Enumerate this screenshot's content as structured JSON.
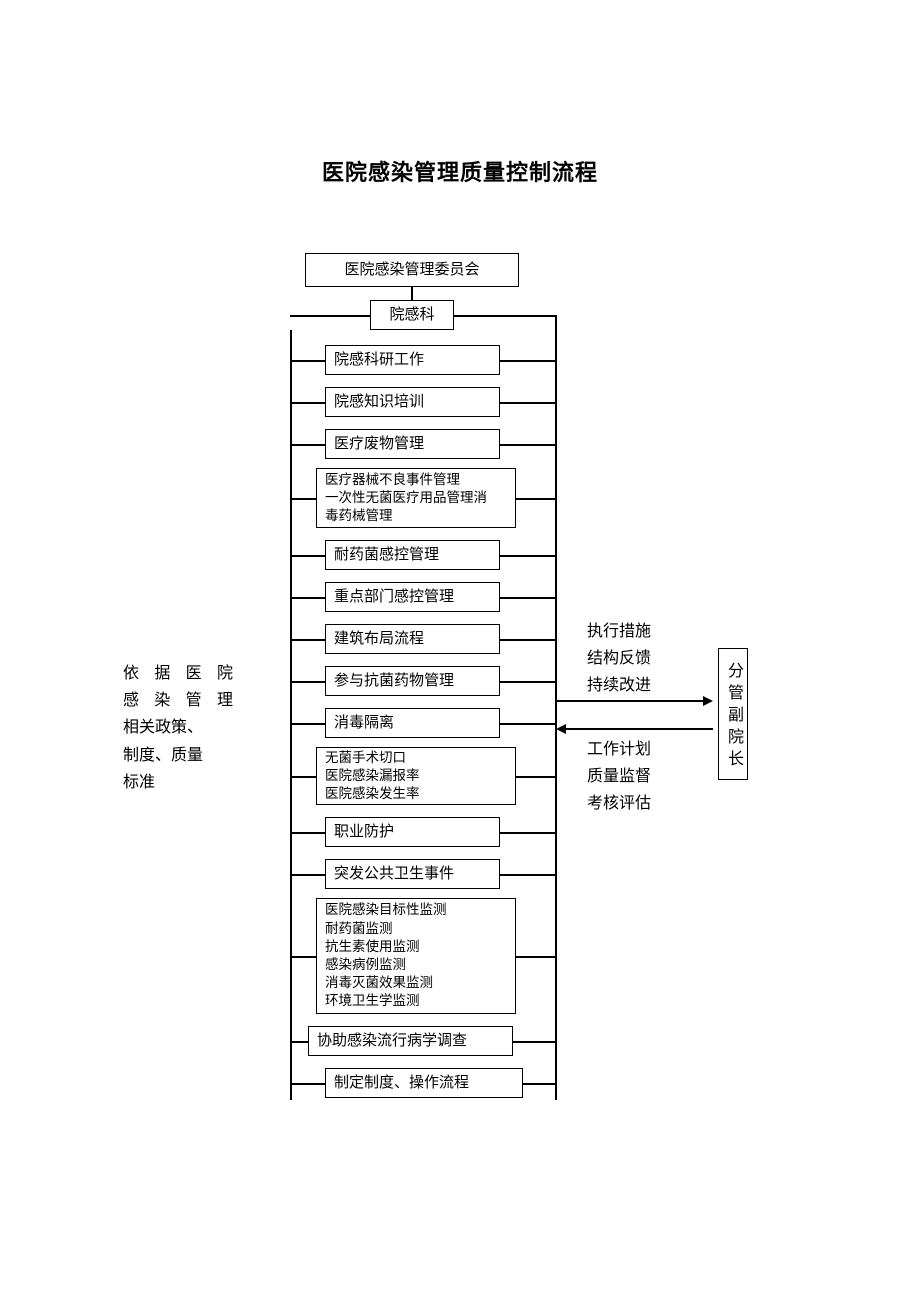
{
  "title": "医院感染管理质量控制流程",
  "top": {
    "committee": "医院感染管理委员会",
    "dept": "院感科"
  },
  "left_note": {
    "l1": "依据医院",
    "l2": "感染管理",
    "l3": "相关政策、",
    "l4": "制度、质量",
    "l5": "标准"
  },
  "items": {
    "i1": "院感科研工作",
    "i2": "院感知识培训",
    "i3": "医疗废物管理",
    "i4a": "医疗器械不良事件管理",
    "i4b": "一次性无菌医疗用品管理消",
    "i4c": "毒药械管理",
    "i5": "耐药菌感控管理",
    "i6": "重点部门感控管理",
    "i7": "建筑布局流程",
    "i8": "参与抗菌药物管理",
    "i9": "消毒隔离",
    "i10a": "无菌手术切口",
    "i10b": "医院感染漏报率",
    "i10c": "医院感染发生率",
    "i11": "职业防护",
    "i12": "突发公共卫生事件",
    "i13a": "医院感染目标性监测",
    "i13b": "耐药菌监测",
    "i13c": "抗生素使用监测",
    "i13d": "感染病例监测",
    "i13e": "消毒灭菌效果监测",
    "i13f": "环境卫生学监测",
    "i14": "协助感染流行病学调查",
    "i15": "制定制度、操作流程"
  },
  "right_upper": {
    "l1": "执行措施",
    "l2": "结构反馈",
    "l3": "持续改进"
  },
  "right_lower": {
    "l1": "工作计划",
    "l2": "质量监督",
    "l3": "考核评估"
  },
  "vice": "分管副院长"
}
